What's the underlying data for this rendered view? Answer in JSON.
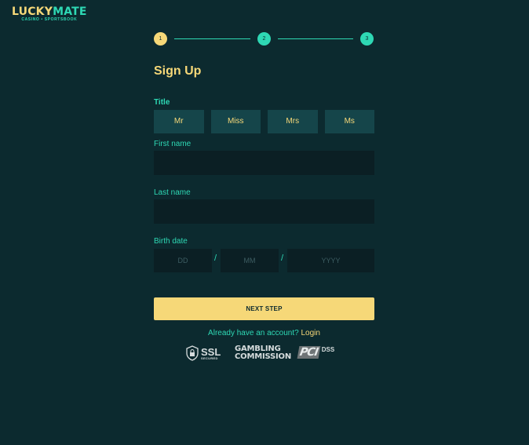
{
  "brand": {
    "name_part1": "LUCKY",
    "name_part2": "MATE",
    "tagline": "CASINO • SPORTSBOOK"
  },
  "steps": {
    "one": "1",
    "two": "2",
    "three": "3"
  },
  "form": {
    "heading": "Sign Up",
    "title_label": "Title",
    "title_options": [
      "Mr",
      "Miss",
      "Mrs",
      "Ms"
    ],
    "first_name_label": "First name",
    "first_name_value": "",
    "last_name_label": "Last name",
    "last_name_value": "",
    "birth_date_label": "Birth date",
    "birth_day_placeholder": "DD",
    "birth_month_placeholder": "MM",
    "birth_year_placeholder": "YYYY",
    "date_separator": "/",
    "next_button": "NEXT STEP",
    "already_text": "Already have an account?",
    "login_link": "Login"
  },
  "badges": {
    "ssl_main": "SSL",
    "ssl_sub": "SECURED",
    "gambling_line1": "GAMBLING",
    "gambling_line2": "COMMISSION",
    "pci_mark": "PCI",
    "pci_dss": "DSS"
  },
  "colors": {
    "background": "#0c2a2f",
    "accent_yellow": "#f6d878",
    "accent_teal": "#2ed8b4",
    "field_bg": "#0b1f24",
    "option_bg": "#15454a"
  }
}
